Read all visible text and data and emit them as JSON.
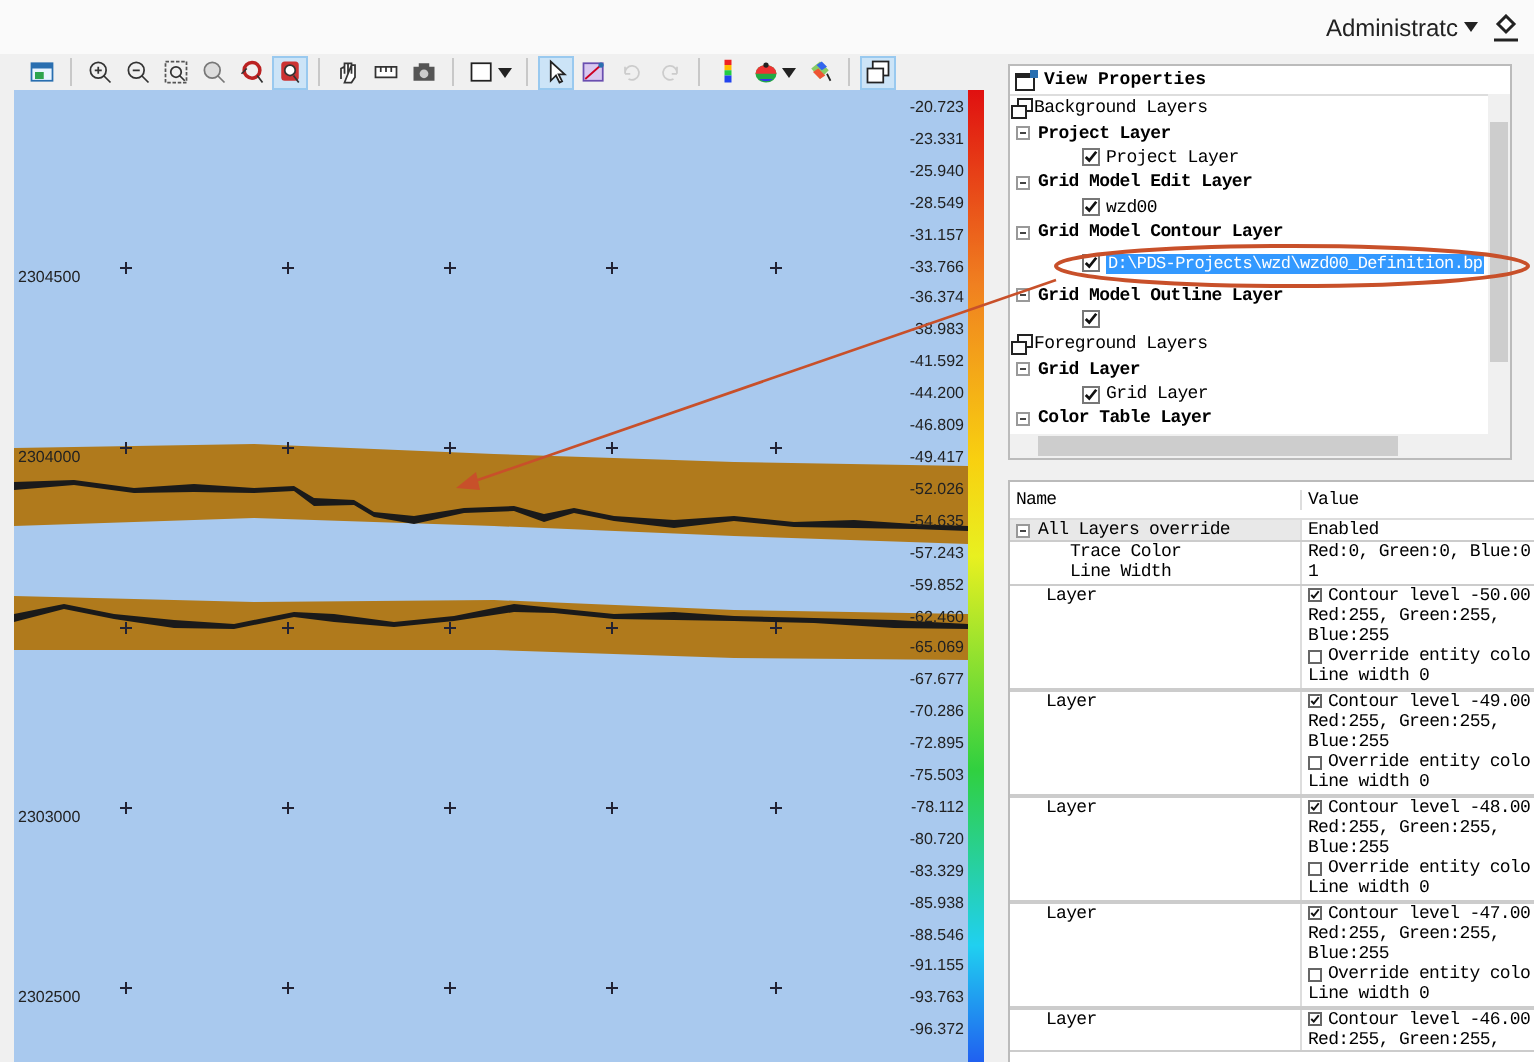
{
  "top_bar": {
    "user": "Administratc"
  },
  "toolbar": [
    {
      "kind": "layer-view",
      "selected": false,
      "disabled": false
    },
    {
      "kind": "separator"
    },
    {
      "kind": "zoom-in",
      "selected": false,
      "disabled": false
    },
    {
      "kind": "zoom-out",
      "selected": false,
      "disabled": false
    },
    {
      "kind": "zoom-window",
      "selected": false,
      "disabled": false
    },
    {
      "kind": "zoom-extent",
      "selected": false,
      "disabled": false
    },
    {
      "kind": "zoom-previous",
      "selected": false,
      "disabled": false
    },
    {
      "kind": "zoom-selection",
      "selected": true,
      "disabled": false
    },
    {
      "kind": "separator"
    },
    {
      "kind": "pan",
      "selected": false,
      "disabled": false
    },
    {
      "kind": "ruler",
      "selected": false,
      "disabled": false
    },
    {
      "kind": "camera",
      "selected": false,
      "disabled": false
    },
    {
      "kind": "separator"
    },
    {
      "kind": "select-shape",
      "selected": false,
      "disabled": false,
      "dropdown": true
    },
    {
      "kind": "separator"
    },
    {
      "kind": "pointer",
      "selected": true,
      "disabled": false
    },
    {
      "kind": "edit-points",
      "selected": false,
      "disabled": false
    },
    {
      "kind": "undo",
      "selected": false,
      "disabled": true
    },
    {
      "kind": "redo",
      "selected": false,
      "disabled": true
    },
    {
      "kind": "separator"
    },
    {
      "kind": "color-scale",
      "selected": false,
      "disabled": false
    },
    {
      "kind": "palette",
      "selected": false,
      "disabled": false,
      "dropdown": true
    },
    {
      "kind": "paint",
      "selected": false,
      "disabled": false
    },
    {
      "kind": "separator"
    },
    {
      "kind": "windows",
      "selected": true,
      "disabled": false
    }
  ],
  "map": {
    "northing_labels": [
      "2304500",
      "2304000",
      "2303000",
      "2302500"
    ],
    "color_scale": [
      "-20.723",
      "-23.331",
      "-25.940",
      "-28.549",
      "-31.157",
      "-33.766",
      "-36.374",
      "-38.983",
      "-41.592",
      "-44.200",
      "-46.809",
      "-49.417",
      "-52.026",
      "-54.635",
      "-57.243",
      "-59.852",
      "-62.460",
      "-65.069",
      "-67.677",
      "-70.286",
      "-72.895",
      "-75.503",
      "-78.112",
      "-80.720",
      "-83.329",
      "-85.938",
      "-88.546",
      "-91.155",
      "-93.763",
      "-96.372"
    ]
  },
  "layer_tree": {
    "title": "View Properties",
    "nodes": [
      {
        "kind": "section",
        "label": "Background Layers"
      },
      {
        "kind": "group",
        "label": "Project Layer",
        "expanded": true,
        "children": [
          {
            "label": "Project Layer",
            "checked": true,
            "selected": false
          }
        ]
      },
      {
        "kind": "group",
        "label": "Grid Model Edit Layer",
        "expanded": true,
        "children": [
          {
            "label": "wzd00",
            "checked": true,
            "selected": false
          }
        ]
      },
      {
        "kind": "group",
        "label": "Grid Model Contour Layer",
        "expanded": true,
        "children": [
          {
            "label": "D:\\PDS-Projects\\wzd\\wzd00_Definition.bp",
            "checked": true,
            "selected": true
          }
        ]
      },
      {
        "kind": "group",
        "label": "Grid Model Outline Layer",
        "expanded": true,
        "children": [
          {
            "checked": true,
            "selected": false
          }
        ]
      },
      {
        "kind": "section",
        "label": "Foreground Layers"
      },
      {
        "kind": "group",
        "label": "Grid Layer",
        "expanded": true,
        "children": [
          {
            "label": "Grid Layer",
            "checked": true,
            "selected": false
          }
        ]
      },
      {
        "kind": "group",
        "label": "Color Table Layer",
        "expanded": true
      }
    ]
  },
  "property_grid": {
    "columns": [
      "Name",
      "Value"
    ],
    "rows": [
      {
        "kind": "category",
        "name": "All Layers override",
        "expanded": true,
        "value": [
          {
            "kind": "text",
            "text": "Enabled"
          }
        ],
        "children": [
          {
            "name": "Trace Color",
            "value": [
              {
                "kind": "text",
                "text": "Red:0, Green:0, Blue:0"
              }
            ]
          },
          {
            "name": "Line Width",
            "value": [
              {
                "kind": "text",
                "text": "1"
              }
            ]
          }
        ]
      },
      {
        "kind": "property",
        "name": "Layer",
        "value": [
          {
            "kind": "checkbox",
            "checked": true,
            "text": "Contour level -50.00"
          },
          {
            "kind": "text",
            "text": "Red:255, Green:255,"
          },
          {
            "kind": "text",
            "text": "Blue:255"
          },
          {
            "kind": "checkbox",
            "checked": false,
            "text": "Override entity colo"
          },
          {
            "kind": "text",
            "text": "Line width 0"
          }
        ]
      },
      {
        "kind": "property",
        "name": "Layer",
        "value": [
          {
            "kind": "checkbox",
            "checked": true,
            "text": "Contour level -49.00"
          },
          {
            "kind": "text",
            "text": "Red:255, Green:255,"
          },
          {
            "kind": "text",
            "text": "Blue:255"
          },
          {
            "kind": "checkbox",
            "checked": false,
            "text": "Override entity colo"
          },
          {
            "kind": "text",
            "text": "Line width 0"
          }
        ]
      },
      {
        "kind": "property",
        "name": "Layer",
        "value": [
          {
            "kind": "checkbox",
            "checked": true,
            "text": "Contour level -48.00"
          },
          {
            "kind": "text",
            "text": "Red:255, Green:255,"
          },
          {
            "kind": "text",
            "text": "Blue:255"
          },
          {
            "kind": "checkbox",
            "checked": false,
            "text": "Override entity colo"
          },
          {
            "kind": "text",
            "text": "Line width 0"
          }
        ]
      },
      {
        "kind": "property",
        "name": "Layer",
        "value": [
          {
            "kind": "checkbox",
            "checked": true,
            "text": "Contour level -47.00"
          },
          {
            "kind": "text",
            "text": "Red:255, Green:255,"
          },
          {
            "kind": "text",
            "text": "Blue:255"
          },
          {
            "kind": "checkbox",
            "checked": false,
            "text": "Override entity colo"
          },
          {
            "kind": "text",
            "text": "Line width 0"
          }
        ]
      },
      {
        "kind": "property",
        "name": "Layer",
        "value": [
          {
            "kind": "checkbox",
            "checked": true,
            "text": "Contour level -46.00"
          },
          {
            "kind": "text",
            "text": "Red:255, Green:255,"
          }
        ]
      }
    ]
  }
}
